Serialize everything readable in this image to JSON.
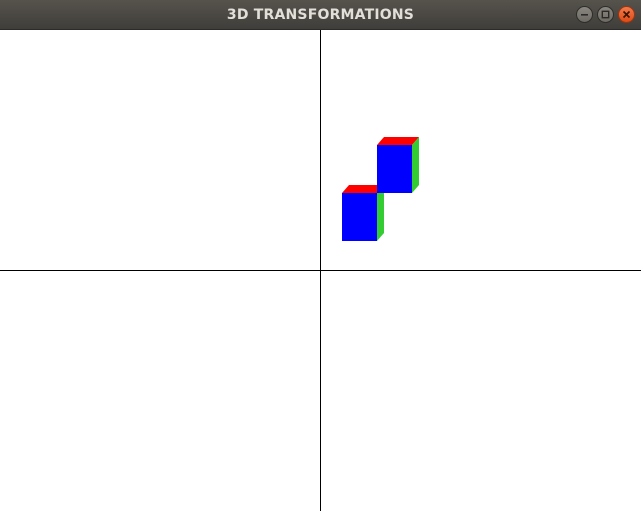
{
  "window": {
    "title": "3D TRANSFORMATIONS",
    "controls": [
      "minimize",
      "maximize",
      "close"
    ]
  },
  "colors": {
    "titlebar": "#4a4844",
    "title_text": "#e2dfd9",
    "close_button": "#e9541f",
    "axis": "#000000",
    "cube_front": "#0000ff",
    "cube_top": "#ff0000",
    "cube_side": "#33cc33"
  },
  "scene": {
    "cubes": [
      {
        "name": "lower-cube",
        "front": [
          21,
          77,
          56,
          29
        ],
        "depth": [
          7,
          8
        ]
      },
      {
        "name": "upper-cube",
        "front": [
          56,
          125,
          91,
          77
        ],
        "depth": [
          7,
          8
        ]
      }
    ]
  }
}
